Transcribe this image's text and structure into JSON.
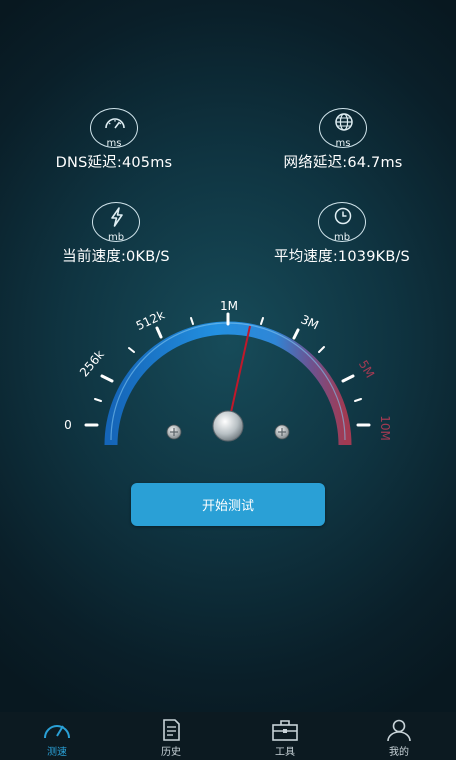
{
  "stats": {
    "dns": {
      "unit": "ms",
      "label": "DNS延迟:405ms",
      "icon": "speedometer-icon"
    },
    "network": {
      "unit": "ms",
      "label": "网络延迟:64.7ms",
      "icon": "globe-icon"
    },
    "current": {
      "unit": "mb",
      "label": "当前速度:0KB/S",
      "icon": "lightning-icon"
    },
    "average": {
      "unit": "mb",
      "label": "平均速度:1039KB/S",
      "icon": "clock-icon"
    }
  },
  "gauge": {
    "scale": [
      "0",
      "256k",
      "512k",
      "1M",
      "3M",
      "5M",
      "10M"
    ],
    "needle_value": "1M",
    "colors": {
      "blue": "#1e7fd8",
      "purple": "#7a4a8a",
      "red": "#a13a52"
    }
  },
  "start_button": {
    "label": "开始测试"
  },
  "tabs": [
    {
      "label": "测速",
      "icon": "speedometer-icon",
      "active": true
    },
    {
      "label": "历史",
      "icon": "document-icon",
      "active": false
    },
    {
      "label": "工具",
      "icon": "toolbox-icon",
      "active": false
    },
    {
      "label": "我的",
      "icon": "person-icon",
      "active": false
    }
  ],
  "colors": {
    "accent": "#2aa0d6"
  }
}
